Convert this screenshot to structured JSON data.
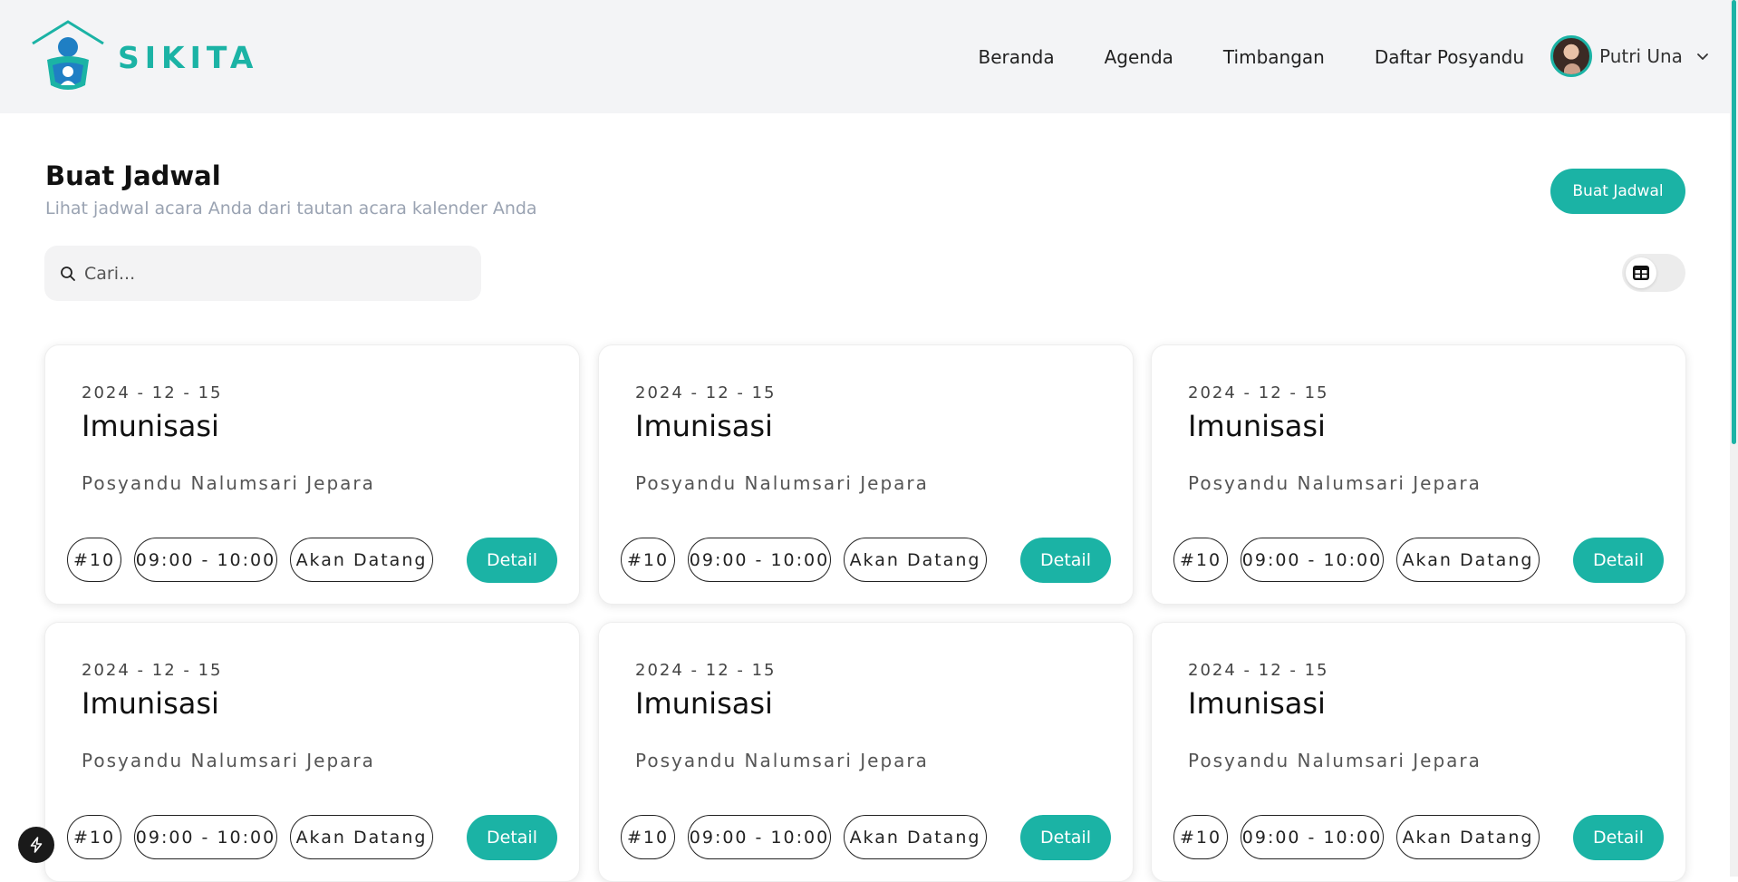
{
  "brand": {
    "name": "SIKITA",
    "logo_icon": "sikita-logo-icon"
  },
  "nav": {
    "links": [
      "Beranda",
      "Agenda",
      "Timbangan",
      "Daftar Posyandu"
    ],
    "user_name": "Putri Una"
  },
  "header": {
    "title": "Buat Jadwal",
    "subtitle": "Lihat jadwal acara Anda dari tautan acara kalender Anda",
    "create_button": "Buat Jadwal"
  },
  "search": {
    "placeholder": "Cari..."
  },
  "colors": {
    "accent": "#1bb3a5",
    "nav_bg": "#f3f4f6"
  },
  "cards": [
    {
      "date": "2024 - 12 - 15",
      "title": "Imunisasi",
      "location": "Posyandu Nalumsari Jepara",
      "number": "#10",
      "time": "09:00 - 10:00",
      "status": "Akan Datang",
      "action": "Detail"
    },
    {
      "date": "2024 - 12 - 15",
      "title": "Imunisasi",
      "location": "Posyandu Nalumsari Jepara",
      "number": "#10",
      "time": "09:00 - 10:00",
      "status": "Akan Datang",
      "action": "Detail"
    },
    {
      "date": "2024 - 12 - 15",
      "title": "Imunisasi",
      "location": "Posyandu Nalumsari Jepara",
      "number": "#10",
      "time": "09:00 - 10:00",
      "status": "Akan Datang",
      "action": "Detail"
    },
    {
      "date": "2024 - 12 - 15",
      "title": "Imunisasi",
      "location": "Posyandu Nalumsari Jepara",
      "number": "#10",
      "time": "09:00 - 10:00",
      "status": "Akan Datang",
      "action": "Detail"
    },
    {
      "date": "2024 - 12 - 15",
      "title": "Imunisasi",
      "location": "Posyandu Nalumsari Jepara",
      "number": "#10",
      "time": "09:00 - 10:00",
      "status": "Akan Datang",
      "action": "Detail"
    },
    {
      "date": "2024 - 12 - 15",
      "title": "Imunisasi",
      "location": "Posyandu Nalumsari Jepara",
      "number": "#10",
      "time": "09:00 - 10:00",
      "status": "Akan Datang",
      "action": "Detail"
    }
  ]
}
